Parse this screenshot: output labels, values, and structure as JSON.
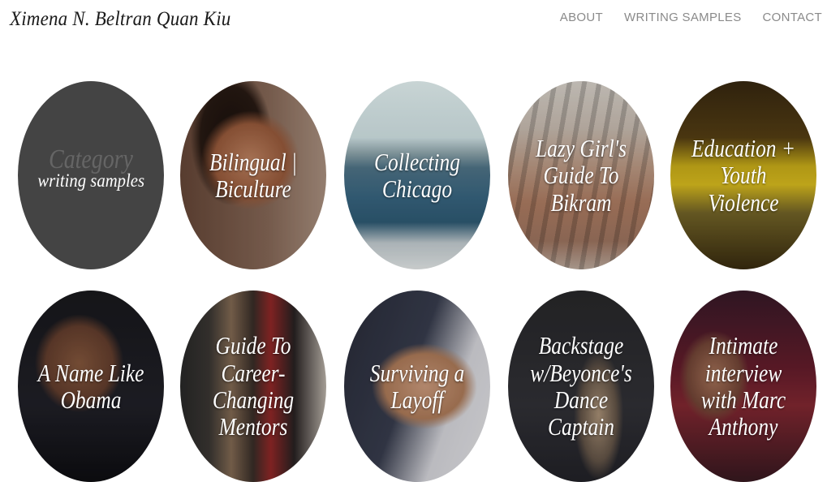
{
  "header": {
    "site_title": "Ximena N. Beltran Quan Kiu",
    "nav": [
      "ABOUT",
      "WRITING SAMPLES",
      "CONTACT"
    ]
  },
  "category_tile": {
    "ghost_text": "Category",
    "label": "writing samples"
  },
  "tiles": [
    {
      "title": "Bilingual | Biculture"
    },
    {
      "title": "Collecting Chicago"
    },
    {
      "title": "Lazy Girl's Guide To Bikram"
    },
    {
      "title": "Education + Youth Violence"
    },
    {
      "title": "A Name Like Obama"
    },
    {
      "title": "Guide To Career-Changing Mentors"
    },
    {
      "title": "Surviving a Layoff"
    },
    {
      "title": "Backstage w/Beyonce's Dance Captain"
    },
    {
      "title": "Intimate interview with Marc Anthony"
    }
  ],
  "colors": {
    "category_bg": "#444444",
    "nav_text": "#8a8a8a",
    "title_text": "#1a1a1a"
  }
}
